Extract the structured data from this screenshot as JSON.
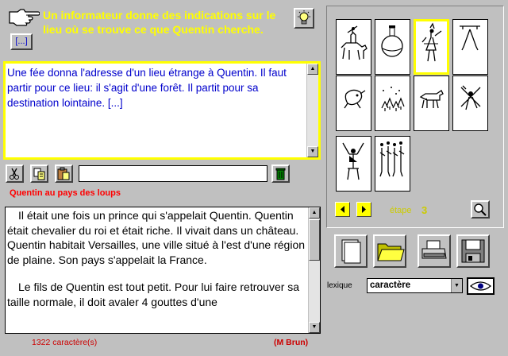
{
  "header": {
    "hand_icon": "pointing-hand-icon",
    "ellipsis_button": "[...]",
    "hint": "Un informateur donne des indications sur le lieu où se trouve ce que Quentin cherche.",
    "bulb_icon": "lightbulb-icon"
  },
  "instruction_box": {
    "text": "Une fée donna l'adresse d'un lieu étrange à Quentin. Il faut partir pour ce lieu: il s'agit d'une forêt.  Il partit pour sa destination lointaine.  [...]"
  },
  "toolbar": {
    "cut_icon": "scissors-icon",
    "copy_icon": "copy-icon",
    "paste_icon": "paste-icon",
    "input_value": "",
    "trash_icon": "trash-icon"
  },
  "story": {
    "title": "Quentin au pays des loups",
    "paragraph1": "Il était une fois un prince qui s'appelait Quentin. Quentin était chevalier du roi et était riche.  Il vivait dans un château. Quentin habitait Versailles, une ville situé à l'est d'une région de plaine. Son pays s'appelait la France.",
    "paragraph2": "Le fils de Quentin est tout petit. Pour lui faire retrouver sa taille normale, il doit avaler 4 gouttes d'une"
  },
  "status": {
    "char_count": "1322 caractère(s)",
    "author": "(M Brun)"
  },
  "cards": [
    {
      "icon": "knight-on-horse-icon"
    },
    {
      "icon": "potion-flask-icon"
    },
    {
      "icon": "fairy-icon",
      "selected": true
    },
    {
      "icon": "journey-figure-icon"
    },
    {
      "icon": "dragon-icon"
    },
    {
      "icon": "forest-icon"
    },
    {
      "icon": "wolf-icon"
    },
    {
      "icon": "fight-icon"
    },
    {
      "icon": "joyful-figure-icon"
    },
    {
      "icon": "family-group-icon"
    }
  ],
  "nav": {
    "prev_icon": "arrow-left-icon",
    "next_icon": "arrow-right-icon",
    "step_label": "étape",
    "step_value": "3",
    "zoom_icon": "magnifier-icon"
  },
  "actions": {
    "new_icon": "new-document-icon",
    "open_icon": "open-folder-icon",
    "print_icon": "printer-icon",
    "save_icon": "floppy-disk-icon"
  },
  "lexique": {
    "label": "lexique",
    "selected": "caractère",
    "eye_icon": "eye-icon"
  },
  "colors": {
    "background": "#c0c0c0",
    "highlight_yellow": "#ffff00",
    "text_blue": "#0000cc",
    "title_red": "#ff0000",
    "status_red": "#cc0000",
    "step_yellow": "#cccc00"
  }
}
